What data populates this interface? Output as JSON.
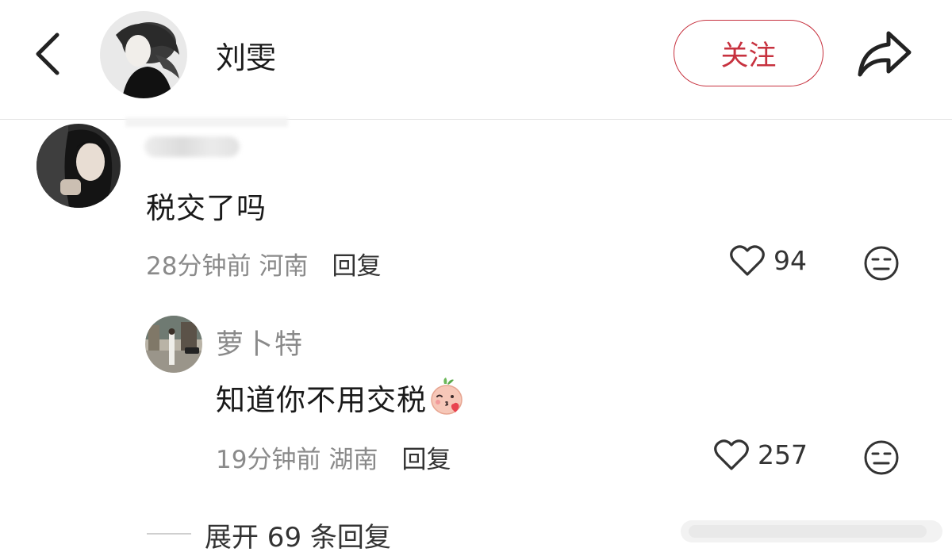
{
  "header": {
    "back_icon": "chevron-left-icon",
    "user_name": "刘雯",
    "follow_label": "关注",
    "share_icon": "share-arrow-icon",
    "accent_color": "#c7323f"
  },
  "comment": {
    "text": "税交了吗",
    "time": "28分钟前",
    "location": "河南",
    "reply_label": "回复",
    "likes": "94",
    "like_icon": "heart-outline-icon",
    "dislike_icon": "meh-face-icon"
  },
  "reply": {
    "user_name": "萝卜特",
    "text": "知道你不用交税",
    "emoji_icon": "radish-kiss-emoji-icon",
    "time": "19分钟前",
    "location": "湖南",
    "reply_label": "回复",
    "likes": "257",
    "like_icon": "heart-outline-icon",
    "dislike_icon": "meh-face-icon"
  },
  "expand": {
    "label": "展开 69 条回复"
  }
}
